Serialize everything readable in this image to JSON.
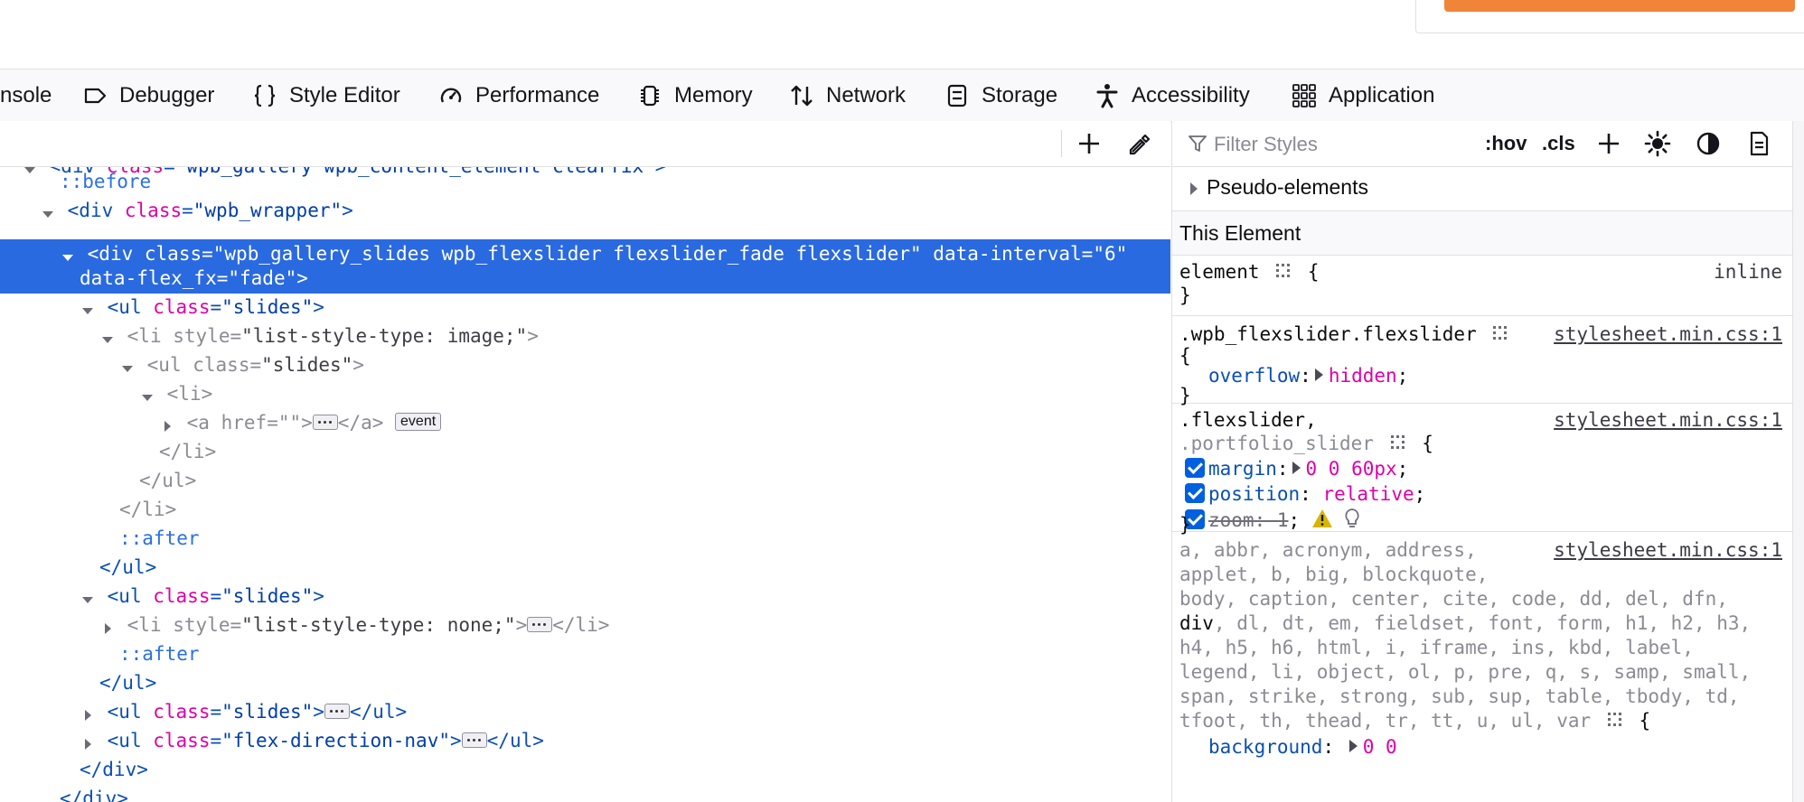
{
  "toolbar": {
    "tabs": [
      {
        "label": "nsole",
        "icon": "console-icon"
      },
      {
        "label": "Debugger",
        "icon": "debugger-icon"
      },
      {
        "label": "Style Editor",
        "icon": "braces-icon"
      },
      {
        "label": "Performance",
        "icon": "gauge-icon"
      },
      {
        "label": "Memory",
        "icon": "chip-icon"
      },
      {
        "label": "Network",
        "icon": "arrows-updown-icon"
      },
      {
        "label": "Storage",
        "icon": "storage-icon"
      },
      {
        "label": "Accessibility",
        "icon": "person-icon"
      },
      {
        "label": "Application",
        "icon": "grid-icon"
      }
    ]
  },
  "markup": {
    "rows": {
      "r0": {
        "tag_open": "<div",
        "attr": "class",
        "eq": "=",
        "val": "\"wpb_gallery wpb_content_element clearfix\"",
        "close": ">"
      },
      "r1": {
        "pseudo": "::before"
      },
      "r2": {
        "tag_open": "<div",
        "attr": "class",
        "eq": "=",
        "val": "\"wpb_wrapper\"",
        "close": ">"
      },
      "r3": {
        "tag_open": "<div",
        "attr": "class",
        "eq": "=",
        "val": "\"wpb_gallery_slides wpb_flexslider flexslider_fade flexslider\"",
        "attr2": "data-interval",
        "eq2": "=",
        "val2": "\"6\""
      },
      "r3b": {
        "attr": "data-flex_fx",
        "eq": "=",
        "val": "\"fade\"",
        "close": ">"
      },
      "r4": {
        "tag_open": "<ul",
        "attr": "class",
        "eq": "=",
        "val": "\"slides\"",
        "close": ">"
      },
      "r5": {
        "tag_open": "<li",
        "attr": "style",
        "eq": "=",
        "val": "\"list-style-type: image;\"",
        "close": ">"
      },
      "r6": {
        "tag_open": "<ul",
        "attr": "class",
        "eq": "=",
        "val": "\"slides\"",
        "close": ">"
      },
      "r7": {
        "tag_open": "<li>"
      },
      "r8": {
        "tag_open": "<a",
        "attr": "href",
        "eq": "=",
        "val": "\"\"",
        "close": ">",
        "end": "</a>",
        "badge": "event"
      },
      "r9": {
        "tag_open": "</li>"
      },
      "r10": {
        "tag_open": "</ul>"
      },
      "r11": {
        "tag_open": "</li>"
      },
      "r12": {
        "pseudo": "::after"
      },
      "r13": {
        "tag_open": "</ul>"
      },
      "r14": {
        "tag_open": "<ul",
        "attr": "class",
        "eq": "=",
        "val": "\"slides\"",
        "close": ">"
      },
      "r15": {
        "tag_open": "<li",
        "attr": "style",
        "eq": "=",
        "val": "\"list-style-type: none;\"",
        "close": ">",
        "end": "</li>"
      },
      "r16": {
        "pseudo": "::after"
      },
      "r17": {
        "tag_open": "</ul>"
      },
      "r18": {
        "tag_open": "<ul",
        "attr": "class",
        "eq": "=",
        "val": "\"slides\"",
        "close": ">",
        "end": "</ul>"
      },
      "r19": {
        "tag_open": "<ul",
        "attr": "class",
        "eq": "=",
        "val": "\"flex-direction-nav\"",
        "close": ">",
        "end": "</ul>"
      },
      "r20": {
        "tag_open": "</div>"
      },
      "r21": {
        "tag_open": "</div>"
      }
    }
  },
  "rules": {
    "filter_placeholder": "Filter Styles",
    "hov": ":hov",
    "cls": ".cls",
    "pseudo_elements": "Pseudo-elements",
    "this_element": "This Element",
    "element_rule": {
      "selector": "element",
      "open": "{",
      "close": "}",
      "source": "inline"
    },
    "flexslider_rule": {
      "selector": ".wpb_flexslider.flexslider",
      "open": "{",
      "close": "}",
      "source": "stylesheet.min.css:1",
      "prop": "overflow",
      "colon": ":",
      "value": "hidden",
      "semi": ";"
    },
    "portfolio_rule": {
      "selector1": ".flexslider,",
      "selector2": ".portfolio_slider",
      "open": "{",
      "close": "}",
      "source": "stylesheet.min.css:1",
      "p1": "margin",
      "v1": "0 0 60px",
      "p2": "position",
      "v2": "relative",
      "p3": "zoom: 1",
      "colon": ":",
      "semi": ";"
    },
    "reset_rule": {
      "source": "stylesheet.min.css:1",
      "lines": [
        "a, abbr, acronym, address,",
        "applet, b, big, blockquote,",
        "body, caption, center, cite, code, dd, del, dfn,",
        "div",
        ", dl, dt, em, fieldset, font, form, h1, h2, h3,",
        "h4, h5, h6, html, i, iframe, ins, kbd, label,",
        "legend, li, object, ol, p, pre, q, s, samp, small,",
        "span, strike, strong, sub, sup, table, tbody, td,",
        "tfoot, th, thead, tr, tt, u, ul, var"
      ],
      "open": "{",
      "next_prop": "background",
      "next_val": "0 0"
    }
  }
}
